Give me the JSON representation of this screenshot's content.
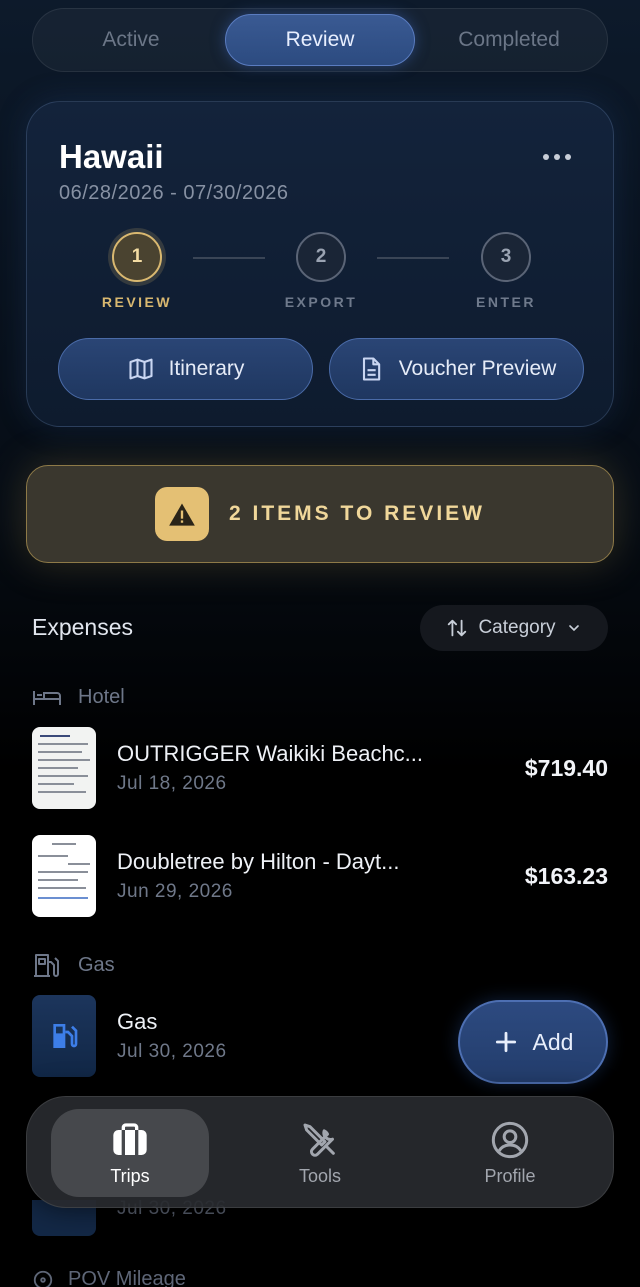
{
  "segments": [
    "Active",
    "Review",
    "Completed"
  ],
  "trip": {
    "title": "Hawaii",
    "dates": "06/28/2026 - 07/30/2026",
    "steps": [
      {
        "number": "1",
        "label": "REVIEW"
      },
      {
        "number": "2",
        "label": "EXPORT"
      },
      {
        "number": "3",
        "label": "ENTER"
      }
    ],
    "itinerary_label": "Itinerary",
    "voucher_label": "Voucher Preview"
  },
  "review_banner": {
    "text": "2 ITEMS TO REVIEW"
  },
  "expenses": {
    "title": "Expenses",
    "sort_label": "Category",
    "categories": {
      "hotel": "Hotel",
      "gas": "Gas",
      "pov": "POV Mileage"
    },
    "items": [
      {
        "name": "OUTRIGGER Waikiki Beachc...",
        "date": "Jul 18, 2026",
        "amount": "$719.40"
      },
      {
        "name": "Doubletree by Hilton - Dayt...",
        "date": "Jun 29, 2026",
        "amount": "$163.23"
      },
      {
        "name": "Gas",
        "date": "Jul 30, 2026",
        "amount": ""
      }
    ],
    "peek_date": "Jul 30, 2026"
  },
  "add_label": "Add",
  "tabs": [
    "Trips",
    "Tools",
    "Profile"
  ],
  "colors": {
    "accent": "#3a5a93",
    "warning": "#e4c074",
    "step_current": "#d9b870"
  }
}
